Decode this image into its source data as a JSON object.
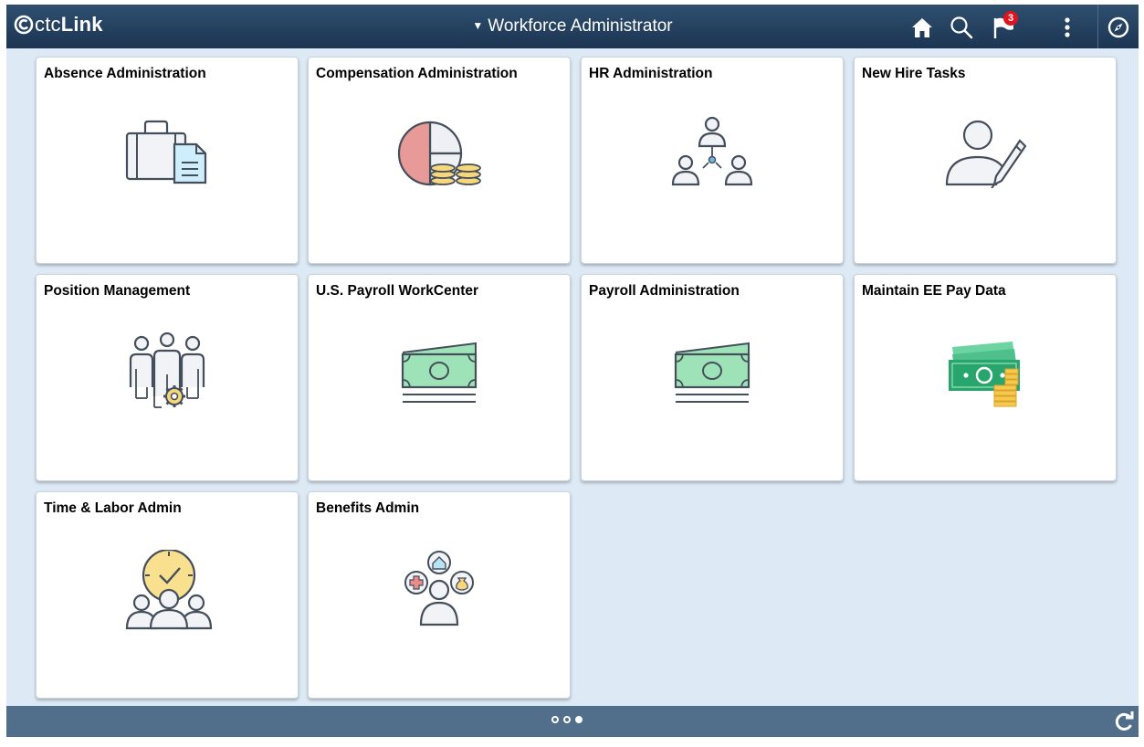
{
  "header": {
    "logo_prefix": "ctc",
    "logo_suffix": "Link",
    "title": "Workforce Administrator",
    "notification_count": "3"
  },
  "tiles": [
    {
      "label": "Absence Administration",
      "icon": "briefcase-document-icon"
    },
    {
      "label": "Compensation Administration",
      "icon": "pie-chart-coins-icon"
    },
    {
      "label": "HR Administration",
      "icon": "org-people-icon"
    },
    {
      "label": "New Hire Tasks",
      "icon": "person-pencil-icon"
    },
    {
      "label": "Position Management",
      "icon": "people-gear-icon"
    },
    {
      "label": "U.S. Payroll WorkCenter",
      "icon": "money-bill-icon"
    },
    {
      "label": "Payroll Administration",
      "icon": "money-bill-icon"
    },
    {
      "label": "Maintain EE Pay Data",
      "icon": "money-coins-icon"
    },
    {
      "label": "Time & Labor Admin",
      "icon": "clock-people-icon"
    },
    {
      "label": "Benefits Admin",
      "icon": "person-benefits-icon"
    }
  ],
  "footer": {
    "page_count": 3,
    "active_page": 3
  },
  "colors": {
    "header_bg": "#1c3553",
    "page_bg": "#dde9f4",
    "footer_bg": "#516f8a",
    "badge": "#e0141e",
    "money_green": "#9ee2b8",
    "pie_red": "#e89a98",
    "coin_yellow": "#f6d77c"
  }
}
